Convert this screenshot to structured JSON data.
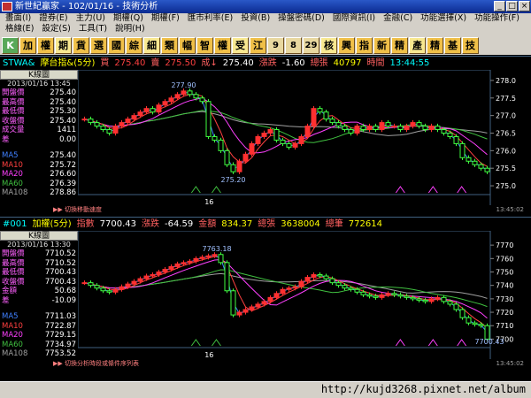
{
  "window": {
    "title": "新世紀贏家 - 102/01/16 - 技術分析",
    "buttons": [
      "_",
      "□",
      "×"
    ]
  },
  "menu": {
    "row1": [
      "畫面(I)",
      "證券(E)",
      "主力(U)",
      "期權(Q)",
      "期權(F)",
      "匯市利率(E)",
      "投資(B)",
      "操盤密碼(D)",
      "國際資訊(I)",
      "金融(C)",
      "功能選擇(X)",
      "功能操作(F)"
    ],
    "row2": [
      "格線(E)",
      "設定(S)",
      "工具(T)",
      "說明(H)"
    ]
  },
  "toolbar": [
    "K",
    "加",
    "權",
    "期",
    "貨",
    "選",
    "國",
    "綜",
    "細",
    "類",
    "幅",
    "智",
    "權",
    "受",
    "江",
    "9",
    "8",
    "29",
    "核",
    "興",
    "指",
    "新",
    "精",
    "產",
    "精",
    "基",
    "技"
  ],
  "panel1": {
    "symbol": "STWA&",
    "name": "摩台指&(5分)",
    "buy_label": "買",
    "buy": "275.40",
    "sell_label": "賣",
    "sell": "275.50",
    "deal_label": "成↓",
    "deal": "275.40",
    "chg_label": "漲跌",
    "chg": "-1.60",
    "vol_label": "總張",
    "vol": "40797",
    "time_label": "時間",
    "time": "13:44:55",
    "ktitle": "K線圖",
    "date": "2013/01/16 13:45",
    "rows": [
      {
        "k": "開盤價",
        "v": "275.40",
        "c": "#ff60ff"
      },
      {
        "k": "最高價",
        "v": "275.40",
        "c": "#ff60ff"
      },
      {
        "k": "最低價",
        "v": "275.30",
        "c": "#ff60ff"
      },
      {
        "k": "收盤價",
        "v": "275.40",
        "c": "#ff60ff"
      },
      {
        "k": "成交量",
        "v": "1411",
        "c": "#ff60ff"
      },
      {
        "k": "差",
        "v": "0.00",
        "c": "#ff60ff"
      }
    ],
    "ma": [
      {
        "k": "MA5",
        "v": "275.40",
        "c": "#4080ff"
      },
      {
        "k": "MA10",
        "v": "275.72",
        "c": "#ff4040"
      },
      {
        "k": "MA20",
        "v": "276.60",
        "c": "#ff40ff"
      },
      {
        "k": "MA60",
        "v": "276.39",
        "c": "#40c040"
      },
      {
        "k": "MA108",
        "v": "278.86",
        "c": "#a0a0a0"
      }
    ],
    "yticks": [
      "278.0",
      "277.5",
      "277.0",
      "276.5",
      "276.0",
      "275.5",
      "275.0"
    ],
    "high_label": "277.90",
    "low_label": "275.20",
    "xlabel": "16",
    "footer": "▶▶ 切換移動速度",
    "footer_time": "13:45:02"
  },
  "panel2": {
    "symbol": "#001",
    "name": "加權(5分)",
    "idx_label": "指數",
    "idx": "7700.43",
    "chg_label": "漲跌",
    "chg": "-64.59",
    "amt_label": "金額",
    "amt": "834.37",
    "vol_label": "總張",
    "vol": "3638004",
    "cnt_label": "總筆",
    "cnt": "772614",
    "ktitle": "K線圖",
    "date": "2013/01/16 13:30",
    "rows": [
      {
        "k": "開盤價",
        "v": "7710.52",
        "c": "#ff60ff"
      },
      {
        "k": "最高價",
        "v": "7710.52",
        "c": "#ff60ff"
      },
      {
        "k": "最低價",
        "v": "7700.43",
        "c": "#ff60ff"
      },
      {
        "k": "收盤價",
        "v": "7700.43",
        "c": "#ff60ff"
      },
      {
        "k": "金額",
        "v": "50.68",
        "c": "#ff60ff"
      },
      {
        "k": "差",
        "v": "-10.09",
        "c": "#ff60ff"
      }
    ],
    "ma": [
      {
        "k": "MA5",
        "v": "7711.03",
        "c": "#4080ff"
      },
      {
        "k": "MA10",
        "v": "7722.87",
        "c": "#ff4040"
      },
      {
        "k": "MA20",
        "v": "7729.15",
        "c": "#ff40ff"
      },
      {
        "k": "MA60",
        "v": "7734.97",
        "c": "#40c040"
      },
      {
        "k": "MA108",
        "v": "7753.52",
        "c": "#a0a0a0"
      }
    ],
    "yticks": [
      "7770",
      "7760",
      "7750",
      "7740",
      "7730",
      "7720",
      "7710",
      "7700"
    ],
    "high_label": "7763.18",
    "low_label": "7700.43",
    "xlabel": "16",
    "footer": "▶▶ 切換分析時段或條件序列表",
    "footer_time": "13:45:02"
  },
  "status": {
    "url": "http://kujd3268.pixnet.net/album"
  },
  "chart_data": [
    {
      "type": "candlestick",
      "title": "摩台指&(5分)",
      "ylim": [
        274.8,
        278.2
      ],
      "close": [
        276.9,
        276.8,
        276.7,
        276.6,
        276.5,
        276.7,
        276.8,
        276.9,
        277.0,
        277.1,
        277.2,
        277.1,
        277.3,
        277.4,
        277.5,
        277.6,
        277.7,
        277.6,
        277.5,
        277.4,
        276.4,
        276.3,
        276.0,
        275.6,
        275.4,
        275.7,
        275.9,
        276.2,
        276.4,
        276.5,
        276.6,
        276.3,
        276.2,
        276.1,
        276.2,
        276.4,
        276.7,
        277.2,
        277.1,
        276.9,
        276.8,
        276.7,
        276.6,
        276.5,
        276.7,
        276.6,
        276.7,
        276.6,
        276.8,
        276.7,
        276.7,
        276.6,
        276.7,
        276.8,
        276.7,
        276.6,
        276.7,
        276.6,
        276.5,
        276.4,
        276.2,
        275.8,
        275.7,
        275.6,
        275.5,
        275.4
      ],
      "ma_colors": {
        "MA5": "#4080ff",
        "MA10": "#ff4040",
        "MA20": "#ff40ff",
        "MA60": "#40c040",
        "MA108": "#a0a0a0"
      }
    },
    {
      "type": "candlestick",
      "title": "加權(5分)",
      "ylim": [
        7695,
        7778
      ],
      "close": [
        7742,
        7740,
        7738,
        7736,
        7735,
        7737,
        7739,
        7741,
        7743,
        7745,
        7747,
        7748,
        7750,
        7752,
        7754,
        7756,
        7757,
        7758,
        7760,
        7761,
        7762,
        7763,
        7757,
        7736,
        7718,
        7720,
        7722,
        7724,
        7726,
        7728,
        7731,
        7734,
        7737,
        7738,
        7739,
        7743,
        7746,
        7748,
        7747,
        7745,
        7742,
        7740,
        7738,
        7737,
        7735,
        7733,
        7732,
        7731,
        7733,
        7734,
        7733,
        7732,
        7731,
        7730,
        7729,
        7728,
        7730,
        7731,
        7728,
        7726,
        7722,
        7716,
        7712,
        7711,
        7710,
        7700
      ],
      "ma_colors": {
        "MA5": "#4080ff",
        "MA10": "#ff4040",
        "MA20": "#ff40ff",
        "MA60": "#40c040",
        "MA108": "#a0a0a0"
      }
    }
  ]
}
